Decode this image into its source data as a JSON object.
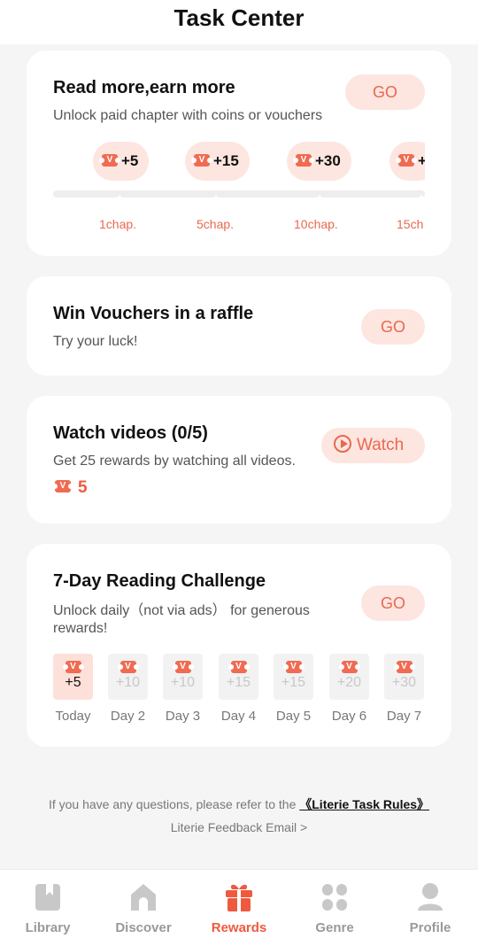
{
  "header": {
    "title": "Task Center"
  },
  "read_card": {
    "title": "Read more,earn more",
    "subtitle": "Unlock paid chapter with coins or vouchers",
    "go_label": "GO",
    "milestones": [
      {
        "reward": "+5",
        "label": "1chap."
      },
      {
        "reward": "+15",
        "label": "5chap."
      },
      {
        "reward": "+30",
        "label": "10chap."
      },
      {
        "reward": "+",
        "label": "15ch"
      }
    ]
  },
  "raffle_card": {
    "title": "Win Vouchers in a raffle",
    "subtitle": "Try your luck!",
    "go_label": "GO"
  },
  "video_card": {
    "title": "Watch videos (0/5)",
    "subtitle": "Get 25 rewards by watching all videos.",
    "reward": "5",
    "watch_label": "Watch"
  },
  "challenge_card": {
    "title": "7-Day Reading Challenge",
    "subtitle": "Unlock daily（not via ads） for generous rewards!",
    "go_label": "GO",
    "days": [
      {
        "value": "+5",
        "label": "Today",
        "active": true
      },
      {
        "value": "+10",
        "label": "Day 2",
        "active": false
      },
      {
        "value": "+10",
        "label": "Day 3",
        "active": false
      },
      {
        "value": "+15",
        "label": "Day 4",
        "active": false
      },
      {
        "value": "+15",
        "label": "Day 5",
        "active": false
      },
      {
        "value": "+20",
        "label": "Day 6",
        "active": false
      },
      {
        "value": "+30",
        "label": "Day 7",
        "active": false
      }
    ]
  },
  "footer": {
    "question_text": "If you have any questions, please refer to the",
    "rules_link": "《Literie Task Rules》",
    "feedback_label": "Literie Feedback Email >"
  },
  "tabbar": {
    "tabs": [
      {
        "label": "Library",
        "icon": "book-icon",
        "active": false
      },
      {
        "label": "Discover",
        "icon": "home-icon",
        "active": false
      },
      {
        "label": "Rewards",
        "icon": "gift-icon",
        "active": true
      },
      {
        "label": "Genre",
        "icon": "grid-icon",
        "active": false
      },
      {
        "label": "Profile",
        "icon": "person-icon",
        "active": false
      }
    ]
  },
  "colors": {
    "accent": "#ef5a3f",
    "accent_light": "#fde5e0",
    "voucher": "#ef6b52"
  }
}
